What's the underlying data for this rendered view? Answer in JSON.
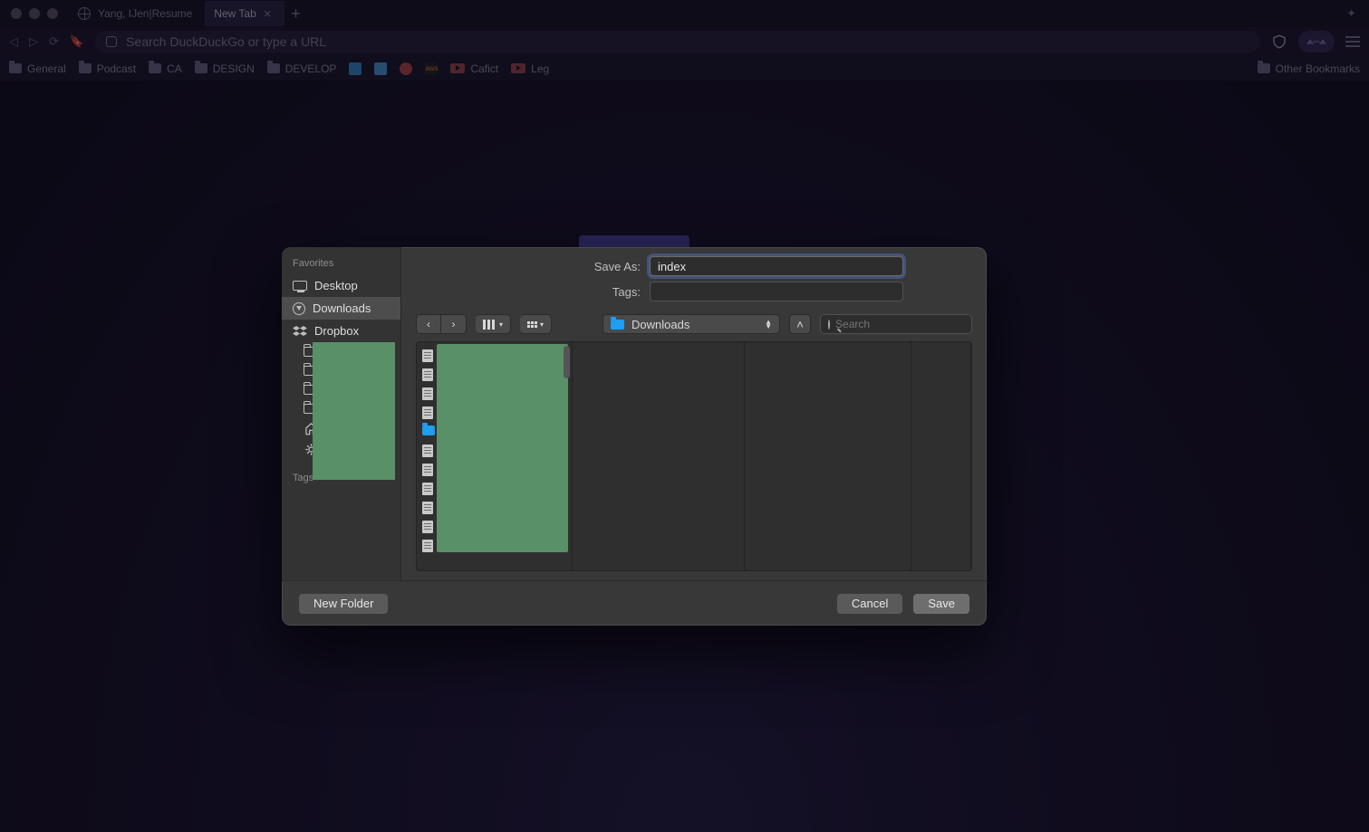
{
  "browser": {
    "tabs": [
      {
        "title": "Yang, IJen|Resume",
        "active": false,
        "closeable": false
      },
      {
        "title": "New Tab",
        "active": true,
        "closeable": true
      }
    ],
    "address_placeholder": "Search DuckDuckGo or type a URL",
    "bookmarks": [
      {
        "label": "General",
        "kind": "folder"
      },
      {
        "label": "Podcast",
        "kind": "folder"
      },
      {
        "label": "CA",
        "kind": "folder"
      },
      {
        "label": "DESIGN",
        "kind": "folder"
      },
      {
        "label": "DEVELOP",
        "kind": "folder"
      },
      {
        "label": "",
        "kind": "app",
        "color": "#3a8fd4"
      },
      {
        "label": "",
        "kind": "app",
        "color": "#4aa0e0"
      },
      {
        "label": "",
        "kind": "app",
        "color": "#b84a4a"
      },
      {
        "label": "",
        "kind": "app",
        "color": "#222",
        "text": "aws",
        "tcolor": "#e58b2e"
      },
      {
        "label": "Cafict",
        "kind": "youtube"
      },
      {
        "label": "Leg",
        "kind": "youtube"
      }
    ],
    "other_bookmarks": "Other Bookmarks"
  },
  "dialog": {
    "save_as_label": "Save As:",
    "save_as_value": "index",
    "tags_label": "Tags:",
    "location_label": "Downloads",
    "search_placeholder": "Search",
    "sidebar": {
      "favorites_header": "Favorites",
      "tags_header": "Tags",
      "items": [
        {
          "label": "Desktop",
          "icon": "desktop",
          "selected": false
        },
        {
          "label": "Downloads",
          "icon": "downloads",
          "selected": true
        },
        {
          "label": "Dropbox",
          "icon": "dropbox",
          "selected": false
        }
      ],
      "extra_icons": [
        "folder",
        "folder",
        "folder",
        "folder",
        "home",
        "applications"
      ]
    },
    "buttons": {
      "new_folder": "New Folder",
      "cancel": "Cancel",
      "save": "Save"
    },
    "file_column_icons": [
      "doc",
      "doc",
      "doc",
      "doc",
      "folder",
      "doc",
      "doc",
      "doc",
      "doc",
      "doc",
      "doc"
    ]
  }
}
